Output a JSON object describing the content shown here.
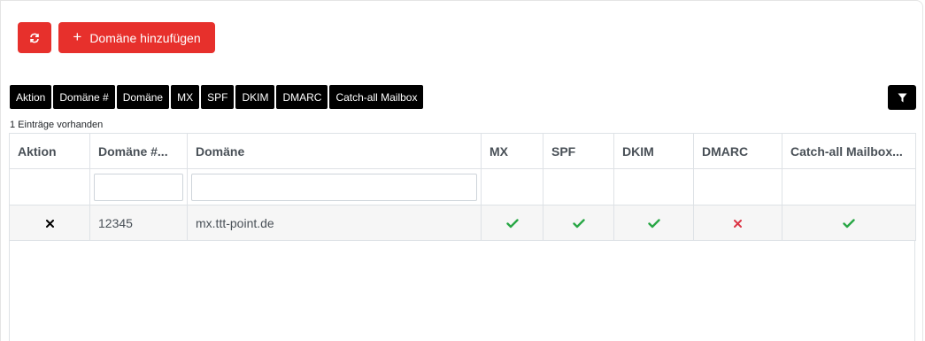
{
  "toolbar": {
    "refresh_icon": "refresh-icon",
    "add_domain_label": "Domäne hinzufügen",
    "add_icon": "plus-icon"
  },
  "column_toggles": [
    "Aktion",
    "Domäne #",
    "Domäne",
    "MX",
    "SPF",
    "DKIM",
    "DMARC",
    "Catch-all Mailbox"
  ],
  "filter_icon": "filter-icon",
  "entries_count": "1 Einträge vorhanden",
  "table": {
    "headers": [
      "Aktion",
      "Domäne #...",
      "Domäne",
      "MX",
      "SPF",
      "DKIM",
      "DMARC",
      "Catch-all Mailbox..."
    ],
    "filter_inputs": {
      "domain_id": "",
      "domain": ""
    },
    "rows": [
      {
        "action_icon": "close-icon",
        "domain_id": "12345",
        "domain": "mx.ttt-point.de",
        "mx": "ok",
        "spf": "ok",
        "dkim": "ok",
        "dmarc": "fail",
        "catch_all": "ok"
      }
    ]
  },
  "colors": {
    "accent_red": "#e7302c",
    "check_green": "#28a745",
    "fail_red": "#dc3545"
  }
}
